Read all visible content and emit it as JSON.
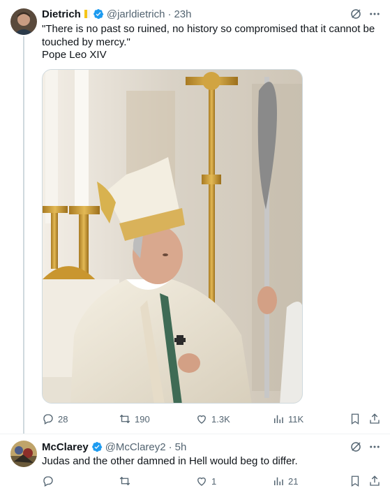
{
  "post": {
    "author_name": "Dietrich",
    "author_handle": "@jarldietrich",
    "time_separator": "·",
    "time": "23h",
    "text_line1": "\"There is no past so ruined, no history so compromised that it cannot be",
    "text_line2": "touched by mercy.\"",
    "text_line3": "Pope Leo XIV",
    "stats": {
      "replies": "28",
      "reposts": "190",
      "likes": "1.3K",
      "views": "11K"
    }
  },
  "reply": {
    "author_name": "McClarey",
    "author_handle": "@McClarey2",
    "time_separator": "·",
    "time": "5h",
    "text": "Judas and the other damned in Hell would beg to differ.",
    "stats": {
      "replies": "",
      "reposts": "",
      "likes": "1",
      "views": "21"
    }
  },
  "colors": {
    "verified": "#1d9bf0",
    "text_primary": "#0f1419",
    "text_secondary": "#536471",
    "border": "#cfd9de"
  },
  "icons": [
    "grok-icon",
    "more-icon",
    "reply-icon",
    "repost-icon",
    "like-icon",
    "views-icon",
    "bookmark-icon",
    "share-icon",
    "verified-icon",
    "flag-icon"
  ]
}
